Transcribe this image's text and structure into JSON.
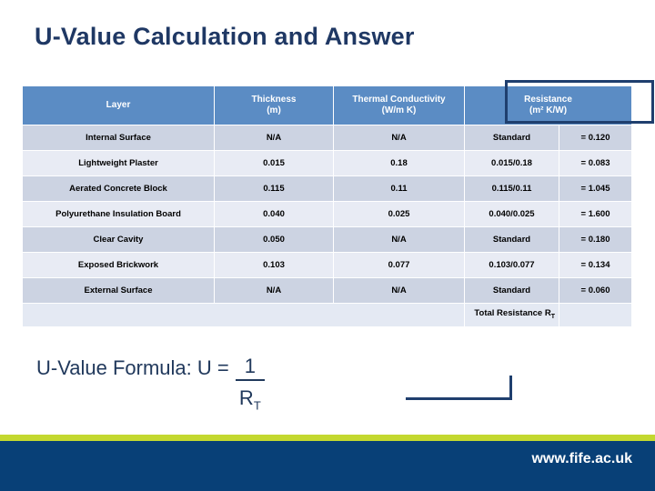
{
  "slide": {
    "title": "U-Value Calculation and Answer",
    "title_color": "#1f3864"
  },
  "table": {
    "header_bg": "#5b8cc4",
    "row_dark_bg": "#ccd3e2",
    "row_light_bg": "#e8ebf4",
    "selection_border_color": "#1f3f6e",
    "columns": [
      {
        "label": "Layer",
        "unit": ""
      },
      {
        "label": "Thickness",
        "unit": "(m)"
      },
      {
        "label": "Thermal Conductivity",
        "unit": "(W/m K)"
      },
      {
        "label": "Resistance",
        "unit": "(m² K/W)"
      }
    ],
    "rows": [
      {
        "layer": "Internal Surface",
        "thickness": "N/A",
        "conductivity": "N/A",
        "resistance_calc": "Standard",
        "resistance_value": "= 0.120"
      },
      {
        "layer": "Lightweight Plaster",
        "thickness": "0.015",
        "conductivity": "0.18",
        "resistance_calc": "0.015/0.18",
        "resistance_value": "= 0.083"
      },
      {
        "layer": "Aerated Concrete Block",
        "thickness": "0.115",
        "conductivity": "0.11",
        "resistance_calc": "0.115/0.11",
        "resistance_value": "= 1.045"
      },
      {
        "layer": "Polyurethane Insulation Board",
        "thickness": "0.040",
        "conductivity": "0.025",
        "resistance_calc": "0.040/0.025",
        "resistance_value": "= 1.600"
      },
      {
        "layer": "Clear Cavity",
        "thickness": "0.050",
        "conductivity": "N/A",
        "resistance_calc": "Standard",
        "resistance_value": "= 0.180"
      },
      {
        "layer": "Exposed Brickwork",
        "thickness": "0.103",
        "conductivity": "0.077",
        "resistance_calc": "0.103/0.077",
        "resistance_value": "= 0.134"
      },
      {
        "layer": "External Surface",
        "thickness": "N/A",
        "conductivity": "N/A",
        "resistance_calc": "Standard",
        "resistance_value": "= 0.060"
      }
    ],
    "total_row": {
      "label": "Total Resistance R",
      "label_subscript": "T",
      "value": ""
    }
  },
  "formula": {
    "label": "U-Value Formula: U =",
    "numerator": "1",
    "denominator": "R",
    "denominator_subscript": "T"
  },
  "footer": {
    "url": "www.fife.ac.uk",
    "bar_color": "#084077",
    "accent_color": "#c3d82f"
  }
}
